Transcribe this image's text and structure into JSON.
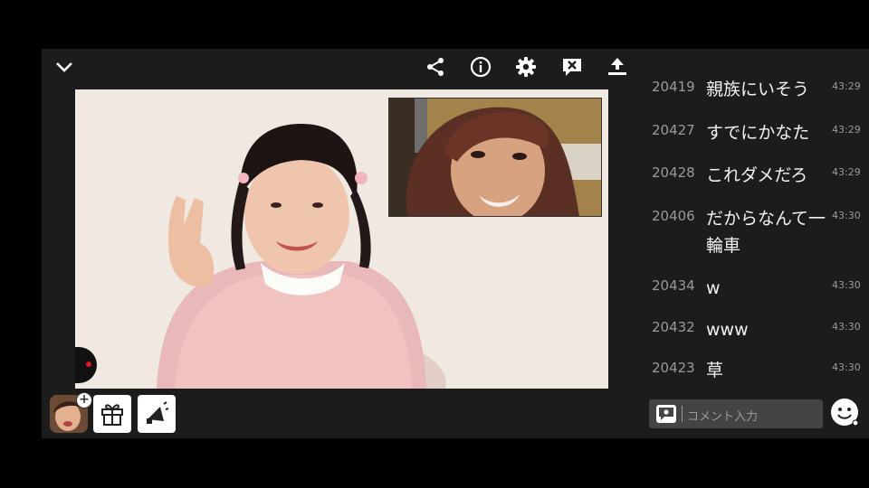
{
  "icons": {
    "collapse": "chevron-down-icon",
    "share": "share-icon",
    "info": "info-icon",
    "settings": "gear-icon",
    "hide_comments": "comment-off-icon",
    "upload": "upload-icon",
    "gift": "gift-icon",
    "megaphone": "megaphone-icon",
    "comment": "comment-icon",
    "emoji": "smile-icon"
  },
  "colors": {
    "live_dot": "#e0162b",
    "background": "#1c1c1c"
  },
  "comments": [
    {
      "num": "20419",
      "text": "親族にいそう",
      "time": "43:29"
    },
    {
      "num": "20427",
      "text": "すでにかなた",
      "time": "43:29"
    },
    {
      "num": "20428",
      "text": "これダメだろ",
      "time": "43:29"
    },
    {
      "num": "20406",
      "text": "だからなんて一輪車",
      "time": "43:30"
    },
    {
      "num": "20434",
      "text": "w",
      "time": "43:30"
    },
    {
      "num": "20432",
      "text": "www",
      "time": "43:30"
    },
    {
      "num": "20423",
      "text": "草",
      "time": "43:30"
    }
  ],
  "comment_input": {
    "placeholder": "コメント入力"
  }
}
